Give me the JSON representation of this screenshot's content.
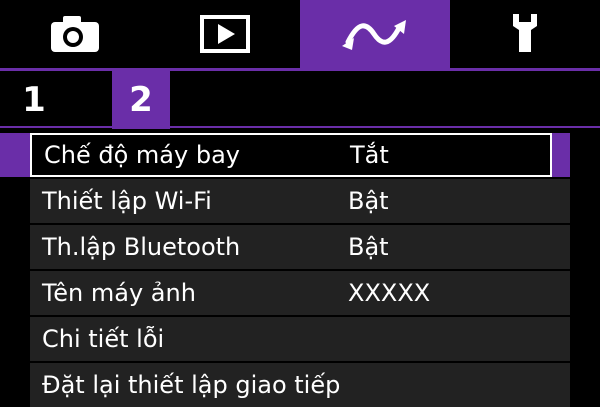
{
  "colors": {
    "background": "#000000",
    "accent": "#6a2ea8",
    "row_background": "#222222",
    "text": "#ffffff"
  },
  "tabs": [
    {
      "icon": "camera-icon",
      "active": false
    },
    {
      "icon": "playback-icon",
      "active": false
    },
    {
      "icon": "wireless-icon",
      "active": true
    },
    {
      "icon": "wrench-icon",
      "active": false
    }
  ],
  "pages": [
    {
      "label": "1",
      "active": false
    },
    {
      "label": "2",
      "active": true
    }
  ],
  "menu": {
    "items": [
      {
        "label": "Chế độ máy bay",
        "value": "Tắt",
        "selected": true
      },
      {
        "label": "Thiết lập Wi-Fi",
        "value": "Bật",
        "selected": false
      },
      {
        "label": "Th.lập Bluetooth",
        "value": "Bật",
        "selected": false
      },
      {
        "label": "Tên máy ảnh",
        "value": "XXXXX",
        "selected": false
      },
      {
        "label": "Chi tiết lỗi",
        "value": "",
        "selected": false
      },
      {
        "label": "Đặt lại thiết lập giao tiếp",
        "value": "",
        "selected": false
      }
    ]
  }
}
